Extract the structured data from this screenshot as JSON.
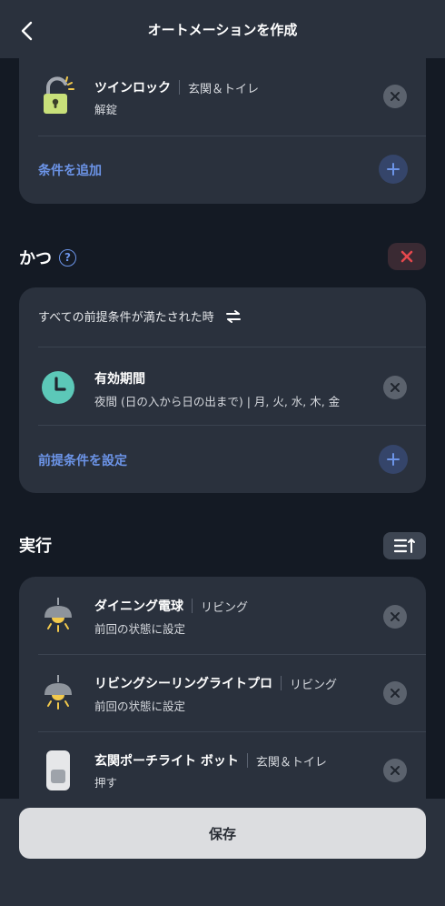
{
  "header": {
    "title": "オートメーションを作成"
  },
  "trigger_card": {
    "item": {
      "title": "ツインロック",
      "room": "玄関＆トイレ",
      "subtitle": "解錠"
    },
    "add_label": "条件を追加"
  },
  "and_section": {
    "title": "かつ",
    "help": "?",
    "condition_text": "すべての前提条件が満たされた時",
    "item": {
      "title": "有効期間",
      "subtitle": "夜間 (日の入から日の出まで) | 月, 火, 水, 木, 金"
    },
    "add_label": "前提条件を設定"
  },
  "run_section": {
    "title": "実行",
    "items": [
      {
        "title": "ダイニング電球",
        "room": "リビング",
        "subtitle": "前回の状態に設定"
      },
      {
        "title": "リビングシーリングライトプロ",
        "room": "リビング",
        "subtitle": "前回の状態に設定"
      },
      {
        "title": "玄関ポーチライト ボット",
        "room": "玄関＆トイレ",
        "subtitle": "押す"
      }
    ]
  },
  "footer": {
    "save_label": "保存"
  },
  "colors": {
    "accent": "#6c94e8",
    "background": "#141a24",
    "card": "#2a313d",
    "danger": "#e5484d",
    "clock": "#5cc8b8",
    "bulb": "#f2c94c"
  }
}
